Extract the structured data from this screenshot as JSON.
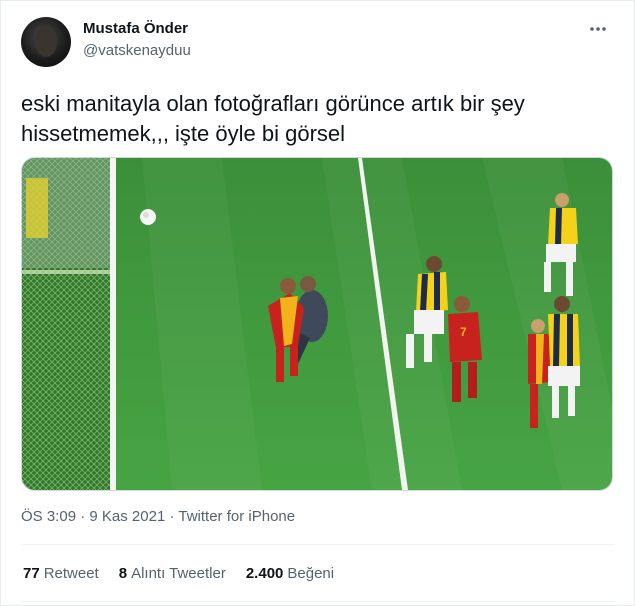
{
  "author": {
    "display_name": "Mustafa Önder",
    "handle": "@vatskenayduu"
  },
  "tweet": {
    "text": "eski manitayla olan fotoğrafları görünce artık bir şey hissetmemek,,, işte öyle bi görsel",
    "time": "ÖS 3:09",
    "separator": "·",
    "date": "9 Kas 2021",
    "source": "Twitter for iPhone"
  },
  "stats": {
    "retweets_count": "77",
    "retweets_label": "Retweet",
    "quotes_count": "8",
    "quotes_label": "Alıntı Tweetler",
    "likes_count": "2.400",
    "likes_label": "Beğeni"
  },
  "icons": {
    "more": "more-icon"
  },
  "colors": {
    "pitch": "#3f9a3c",
    "galatasaray_red": "#c8221e",
    "galatasaray_yellow": "#f2b21a",
    "fenerbahce_navy": "#1e2a4a",
    "fenerbahce_yellow": "#f5d21a"
  }
}
